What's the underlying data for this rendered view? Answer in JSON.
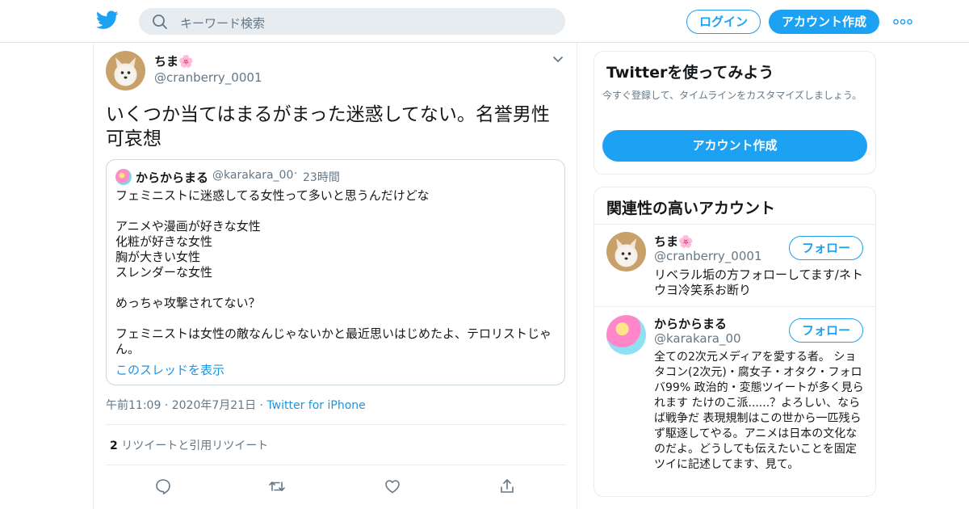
{
  "header": {
    "search_placeholder": "キーワード検索",
    "login_label": "ログイン",
    "signup_label": "アカウント作成",
    "brand_color": "#1da1f2"
  },
  "tweet": {
    "author_name": "ちま🌸",
    "author_handle": "@cranberry_0001",
    "text": "いくつか当てはまるがまった迷惑してない。名誉男性可哀想",
    "quote": {
      "author_name": "からからまる",
      "author_handle": "@karakara_00",
      "separator": "·",
      "time": "23時間",
      "lines": [
        "フェミニストに迷惑してる女性って多いと思うんだけどな",
        "",
        "アニメや漫画が好きな女性",
        "化粧が好きな女性",
        "胸が大きい女性",
        "スレンダーな女性",
        "",
        "めっちゃ攻撃されてない？",
        "",
        "フェミニストは女性の敵なんじゃないかと最近思いはじめたよ、テロリストじゃん。"
      ],
      "thread_link": "このスレッドを表示"
    },
    "time": "午前11:09",
    "date": "2020年7月21日",
    "meta_sep": "·",
    "via": "Twitter for iPhone",
    "retweet_count": "2",
    "retweet_label": "リツイートと引用リツイート"
  },
  "sidebar": {
    "try_title": "Twitterを使ってみよう",
    "try_sub": "今すぐ登録して、タイムラインをカスタマイズしましょう。",
    "try_cta": "アカウント作成",
    "related_title": "関連性の高いアカウント",
    "accounts": [
      {
        "name": "ちま🌸",
        "handle": "@cranberry_0001",
        "follow": "フォロー",
        "bio": "リベラル垢の方フォローしてます/ネトウヨ冷笑系お断り"
      },
      {
        "name": "からからまる",
        "handle": "@karakara_00",
        "follow": "フォロー",
        "bio": "全ての2次元メディアを愛する者。 ショタコン(2次元)・腐女子・オタク・フォロバ99% 政治的・変態ツイートが多く見られます たけのこ派......？よろしい、ならば戦争だ 表現規制はこの世から一匹残らず駆逐してやる。アニメは日本の文化なのだよ。どうしても伝えたいことを固定ツイに記述してます、見て。"
      }
    ]
  }
}
